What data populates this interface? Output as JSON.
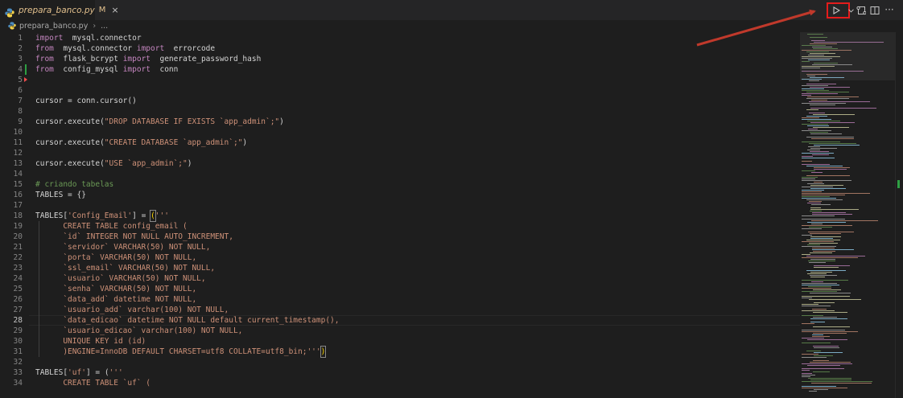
{
  "tab": {
    "title": "prepara_banco.py",
    "modified": "M",
    "close": "×"
  },
  "breadcrumb": {
    "file": "prepara_banco.py",
    "ellipsis": "..."
  },
  "actions": {
    "more": "···"
  },
  "editor": {
    "active_line": 28,
    "lines": [
      {
        "n": "1",
        "tokens": [
          [
            "kw",
            "import"
          ],
          [
            "",
            "mysql.connector"
          ]
        ]
      },
      {
        "n": "2",
        "tokens": [
          [
            "kw",
            "from"
          ],
          [
            "",
            "mysql.connector "
          ],
          [
            "kw",
            "import"
          ],
          [
            "",
            "errorcode"
          ]
        ]
      },
      {
        "n": "3",
        "tokens": [
          [
            "kw",
            "from"
          ],
          [
            "",
            "flask_bcrypt "
          ],
          [
            "kw",
            "import"
          ],
          [
            "",
            "generate_password_hash"
          ]
        ]
      },
      {
        "n": "4",
        "tokens": [
          [
            "kw",
            "from"
          ],
          [
            "",
            "config_mysql "
          ],
          [
            "kw",
            "import"
          ],
          [
            "",
            "conn"
          ]
        ]
      },
      {
        "n": "5",
        "tokens": []
      },
      {
        "n": "6",
        "tokens": []
      },
      {
        "n": "7",
        "tokens": [
          [
            "",
            "cursor = conn.cursor()"
          ]
        ]
      },
      {
        "n": "8",
        "tokens": []
      },
      {
        "n": "9",
        "tokens": [
          [
            "",
            "cursor.execute("
          ],
          [
            "str",
            "\"DROP DATABASE IF EXISTS `app_admin`;\""
          ],
          [
            "",
            ")"
          ]
        ]
      },
      {
        "n": "10",
        "tokens": []
      },
      {
        "n": "11",
        "tokens": [
          [
            "",
            "cursor.execute("
          ],
          [
            "str",
            "\"CREATE DATABASE `app_admin`;\""
          ],
          [
            "",
            ")"
          ]
        ]
      },
      {
        "n": "12",
        "tokens": []
      },
      {
        "n": "13",
        "tokens": [
          [
            "",
            "cursor.execute("
          ],
          [
            "str",
            "\"USE `app_admin`;\""
          ],
          [
            "",
            ")"
          ]
        ]
      },
      {
        "n": "14",
        "tokens": []
      },
      {
        "n": "15",
        "tokens": [
          [
            "cmt",
            "# criando tabelas"
          ]
        ]
      },
      {
        "n": "16",
        "tokens": [
          [
            "",
            "TABLES = {}"
          ]
        ]
      },
      {
        "n": "17",
        "tokens": []
      },
      {
        "n": "18",
        "tokens": [
          [
            "",
            "TABLES["
          ],
          [
            "str",
            "'Config_Email'"
          ],
          [
            "",
            "] = "
          ],
          [
            "boxbr",
            "("
          ],
          [
            "str",
            "'''"
          ]
        ]
      },
      {
        "n": "19",
        "tokens": [
          [
            "str",
            "      CREATE TABLE config_email ("
          ]
        ]
      },
      {
        "n": "20",
        "tokens": [
          [
            "str",
            "      `id` INTEGER NOT NULL AUTO_INCREMENT,"
          ]
        ]
      },
      {
        "n": "21",
        "tokens": [
          [
            "str",
            "      `servidor` VARCHAR(50) NOT NULL,"
          ]
        ]
      },
      {
        "n": "22",
        "tokens": [
          [
            "str",
            "      `porta` VARCHAR(50) NOT NULL,"
          ]
        ]
      },
      {
        "n": "23",
        "tokens": [
          [
            "str",
            "      `ssl_email` VARCHAR(50) NOT NULL,"
          ]
        ]
      },
      {
        "n": "24",
        "tokens": [
          [
            "str",
            "      `usuario` VARCHAR(50) NOT NULL,"
          ]
        ]
      },
      {
        "n": "25",
        "tokens": [
          [
            "str",
            "      `senha` VARCHAR(50) NOT NULL,"
          ]
        ]
      },
      {
        "n": "26",
        "tokens": [
          [
            "str",
            "      `data_add` datetime NOT NULL,"
          ]
        ]
      },
      {
        "n": "27",
        "tokens": [
          [
            "str",
            "      `usuario_add` varchar(100) NOT NULL,"
          ]
        ]
      },
      {
        "n": "28",
        "tokens": [
          [
            "str",
            "      `data_edicao` datetime NOT NULL default current_timestamp(),"
          ]
        ]
      },
      {
        "n": "29",
        "tokens": [
          [
            "str",
            "      `usuario_edicao` varchar(100) NOT NULL,"
          ]
        ]
      },
      {
        "n": "30",
        "tokens": [
          [
            "str",
            "      UNIQUE KEY id (id)"
          ]
        ]
      },
      {
        "n": "31",
        "tokens": [
          [
            "str",
            "      )ENGINE=InnoDB DEFAULT CHARSET=utf8 COLLATE=utf8_bin;'''"
          ],
          [
            "boxbr",
            ")"
          ]
        ]
      },
      {
        "n": "32",
        "tokens": []
      },
      {
        "n": "33",
        "tokens": [
          [
            "",
            "TABLES["
          ],
          [
            "str",
            "'uf'"
          ],
          [
            "",
            "] = ("
          ],
          [
            "str",
            "'''"
          ]
        ]
      },
      {
        "n": "34",
        "tokens": [
          [
            "str",
            "      CREATE TABLE `uf` ("
          ]
        ]
      }
    ]
  },
  "colors": {
    "background": "#1e1e1e",
    "keyword": "#c586c0",
    "string": "#ce9178",
    "comment": "#6a9955",
    "highlight_box": "#e51c1c",
    "annotation_arrow": "#c0392b",
    "git_modified": "#2ea043"
  }
}
